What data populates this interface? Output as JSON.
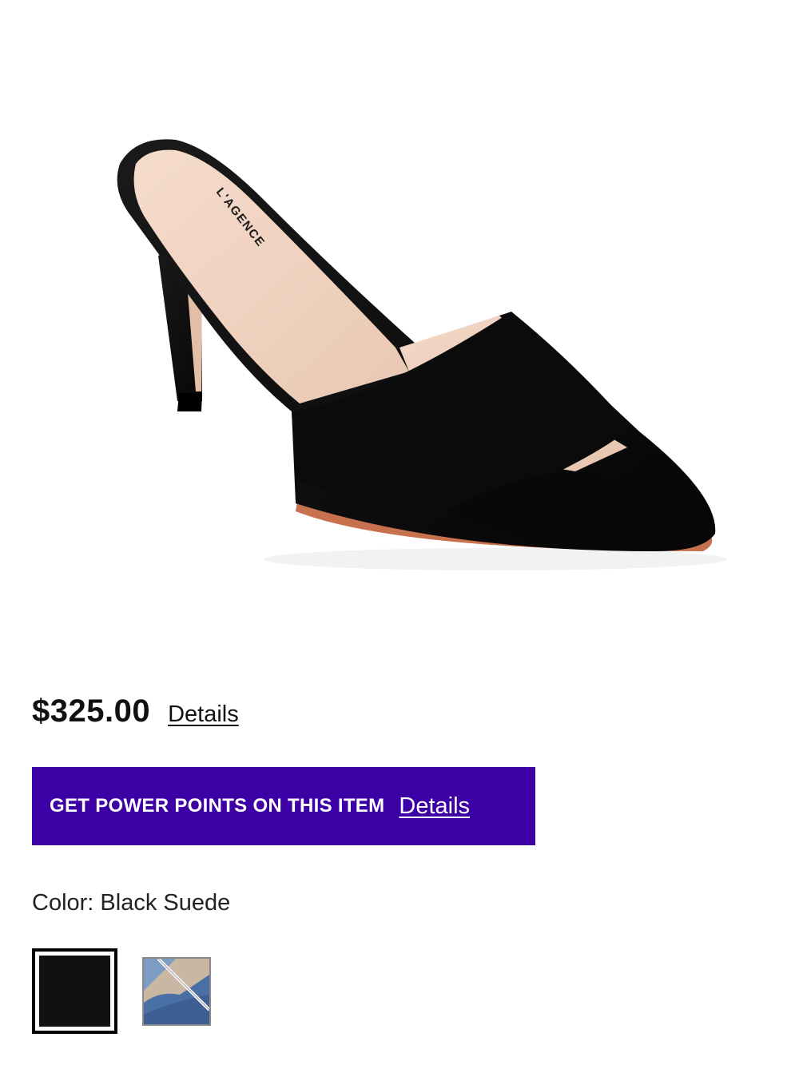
{
  "product": {
    "image_alt": "Black suede pointed-toe mule heel",
    "insole_brand": "L'AGENCE"
  },
  "pricing": {
    "price": "$325.00",
    "details_link": "Details"
  },
  "power_points": {
    "text": "GET POWER POINTS ON THIS ITEM",
    "details_link": "Details",
    "background_color": "#3c00a5"
  },
  "color": {
    "label": "Color: Black Suede",
    "swatches": [
      {
        "name": "Black Suede",
        "selected": true,
        "color": "#111111"
      },
      {
        "name": "Denim",
        "selected": false,
        "color": "#4a6fa5"
      }
    ]
  }
}
